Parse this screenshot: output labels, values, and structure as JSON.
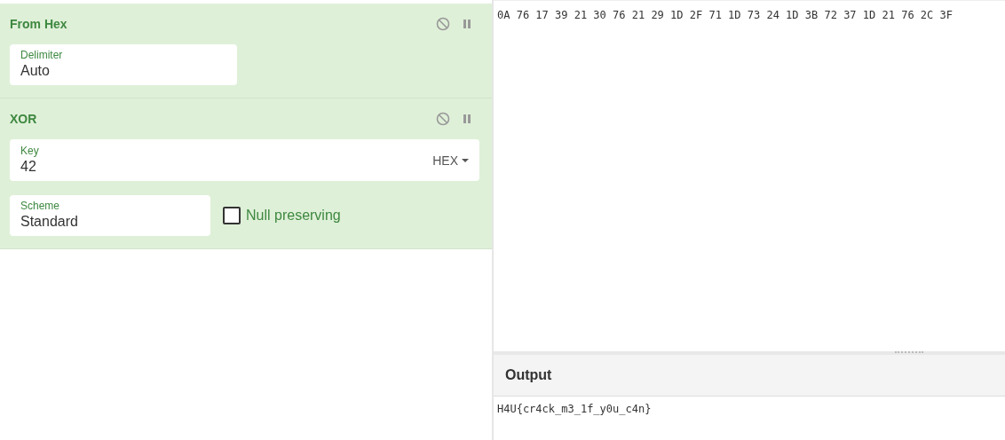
{
  "recipe": {
    "operations": [
      {
        "name": "From Hex",
        "args": [
          {
            "kind": "select",
            "label": "Delimiter",
            "value": "Auto"
          }
        ]
      },
      {
        "name": "XOR",
        "args": [
          {
            "kind": "toggle",
            "label": "Key",
            "value": "42",
            "option": "HEX"
          },
          {
            "kind": "select",
            "label": "Scheme",
            "value": "Standard"
          },
          {
            "kind": "checkbox",
            "label": "Null preserving",
            "checked": false
          }
        ]
      }
    ]
  },
  "input": {
    "text": "0A 76 17 39 21 30 76 21 29 1D 2F 71 1D 73 24 1D 3B 72 37 1D 21 76 2C 3F"
  },
  "output": {
    "title": "Output",
    "text": "H4U{cr4ck_m3_1f_y0u_c4n}"
  }
}
